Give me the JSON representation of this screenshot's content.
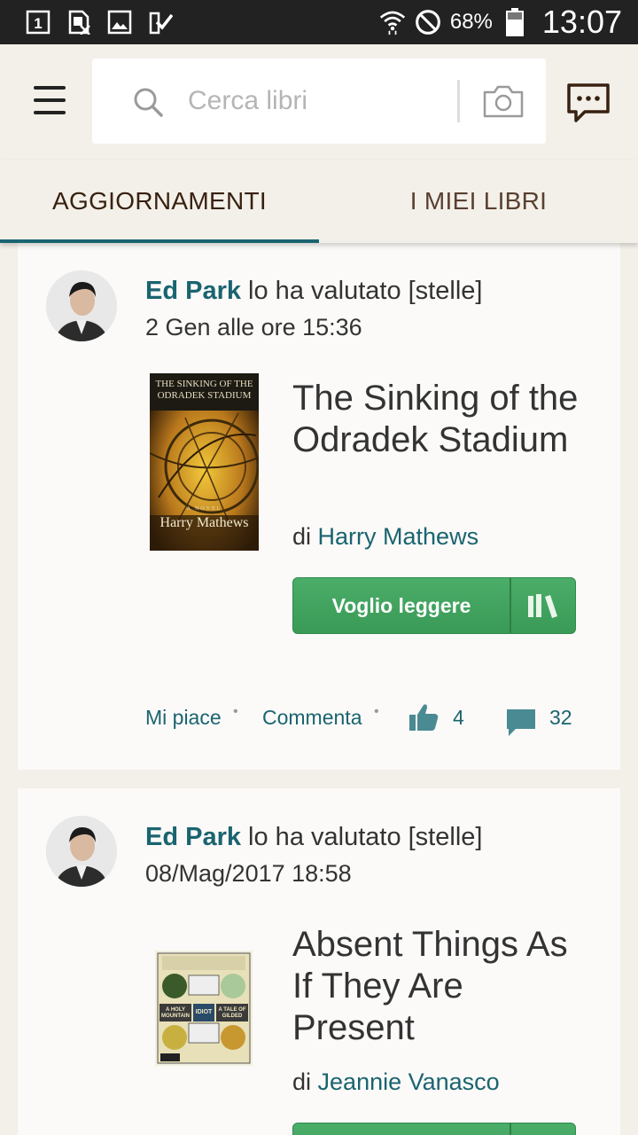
{
  "status_bar": {
    "battery_pct": "68%",
    "time": "13:07",
    "icons": [
      "sim-1-icon",
      "no-sim-icon",
      "image-icon",
      "checklist-icon",
      "wifi-icon",
      "do-not-disturb-icon",
      "battery-icon"
    ]
  },
  "search": {
    "placeholder": "Cerca libri"
  },
  "tabs": [
    {
      "label": "AGGIORNAMENTI",
      "active": true
    },
    {
      "label": "I MIEI LIBRI",
      "active": false
    }
  ],
  "colors": {
    "accent": "#1a6470",
    "button_green": "#3ea35b",
    "background": "#f3f0e9",
    "card": "#fbfaf8"
  },
  "feed": [
    {
      "user": "Ed Park",
      "action": " lo ha valutato [stelle]",
      "date": "2 Gen alle ore 15:36",
      "book_title": "The Sinking of the Odradek Stadium",
      "by": "di ",
      "author": "Harry Mathews",
      "cover_title": "THE SINKING OF THE ODRADEK STADIUM",
      "cover_author": "Harry Mathews",
      "cover_subtitle": "A NOVEL",
      "want_label": "Voglio leggere",
      "like_label": "Mi piace",
      "comment_label": "Commenta",
      "likes": "4",
      "comments": "32"
    },
    {
      "user": "Ed Park",
      "action": " lo ha valutato [stelle]",
      "date": "08/Mag/2017 18:58",
      "book_title": "Absent Things As If They Are Present",
      "by": "di ",
      "author": "Jeannie Vanasco",
      "cover_labels": [
        "A HOLY MOUNTAIN",
        "A TALE OF GILDED",
        "IDIOT"
      ]
    }
  ]
}
